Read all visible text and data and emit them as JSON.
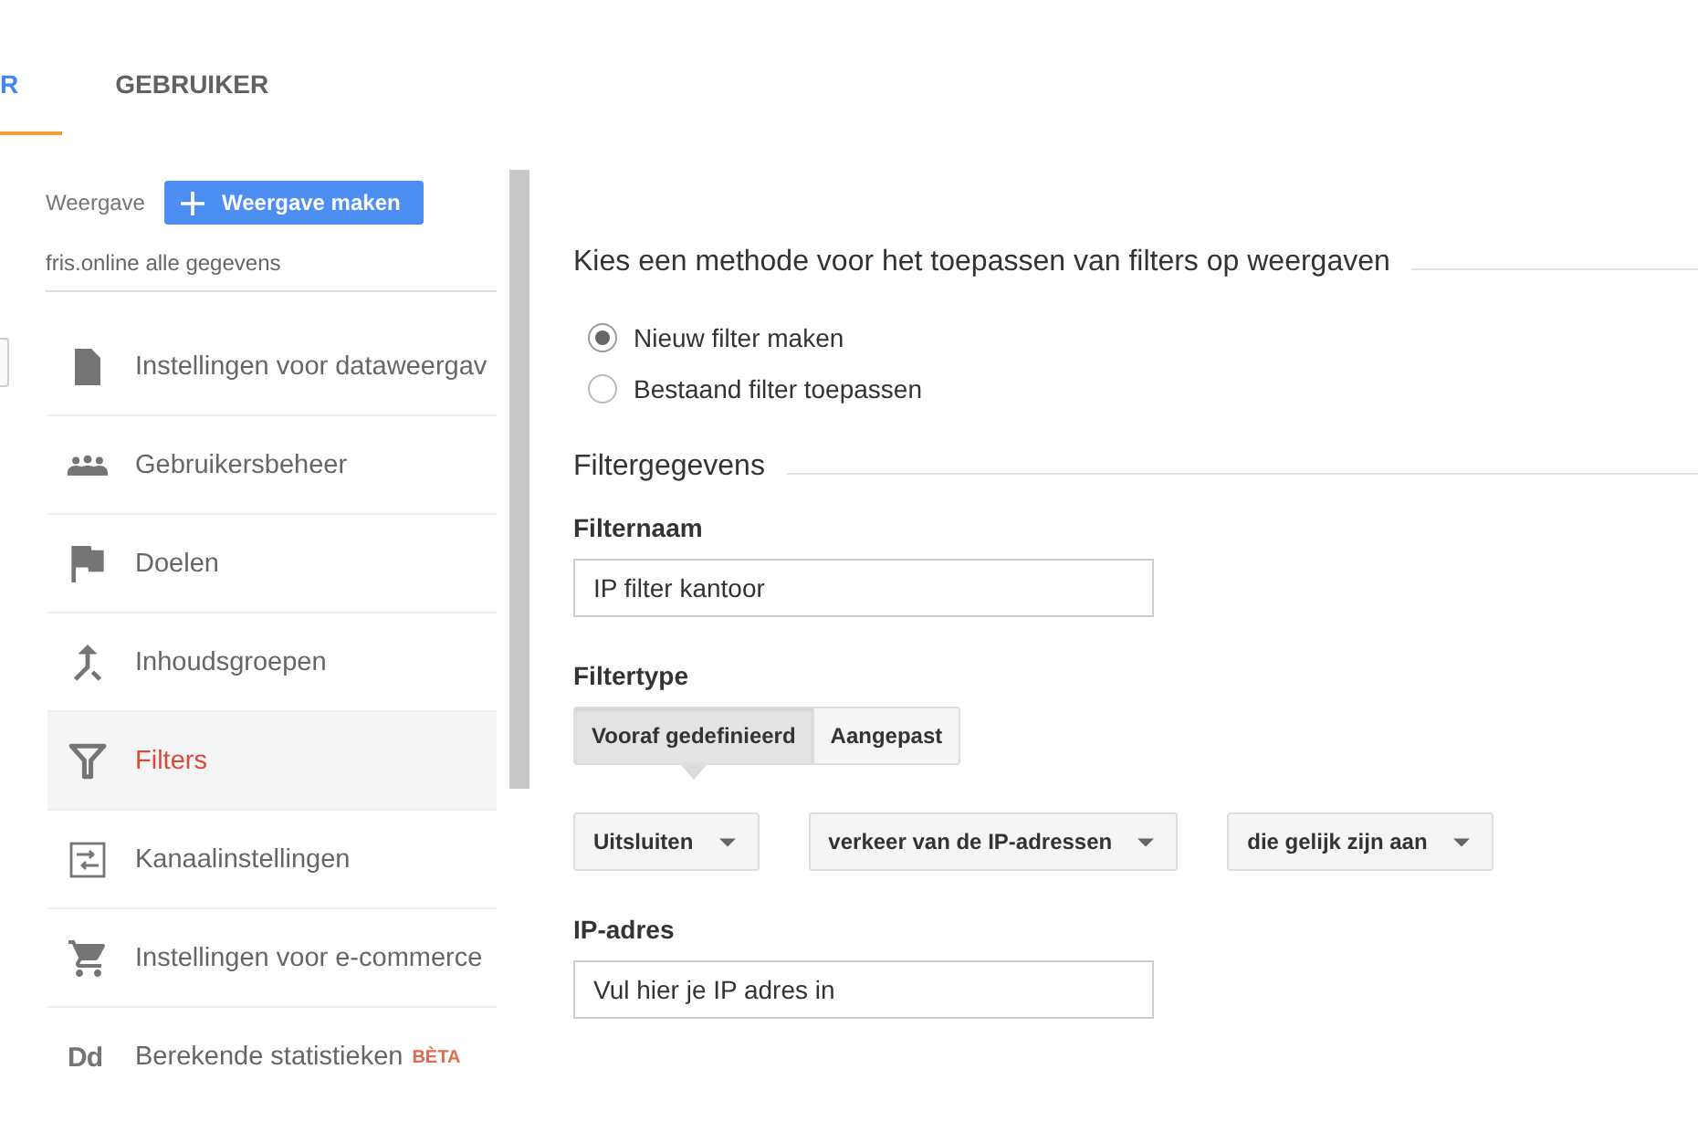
{
  "tabs": [
    {
      "label": "R",
      "selected": true
    },
    {
      "label": "GEBRUIKER",
      "selected": false
    }
  ],
  "sidebar": {
    "view_label": "Weergave",
    "create_button": "Weergave maken",
    "view_name": "fris.online alle gegevens",
    "items": [
      {
        "label": "Instellingen voor dataweergav",
        "selected": false
      },
      {
        "label": "Gebruikersbeheer",
        "selected": false
      },
      {
        "label": "Doelen",
        "selected": false
      },
      {
        "label": "Inhoudsgroepen",
        "selected": false
      },
      {
        "label": "Filters",
        "selected": true
      },
      {
        "label": "Kanaalinstellingen",
        "selected": false
      },
      {
        "label": "Instellingen voor e-commerce",
        "selected": false
      },
      {
        "label": "Berekende statistieken",
        "selected": false,
        "icon_text": "Dd",
        "badge": "BÈTA"
      }
    ]
  },
  "method": {
    "title": "Kies een methode voor het toepassen van filters op weergaven",
    "options": [
      {
        "label": "Nieuw filter maken",
        "selected": true
      },
      {
        "label": "Bestaand filter toepassen",
        "selected": false
      }
    ]
  },
  "filter_details": {
    "title": "Filtergegevens",
    "name_label": "Filternaam",
    "name_value": "IP filter kantoor",
    "type_label": "Filtertype",
    "type_options": [
      {
        "label": "Vooraf gedefinieerd",
        "selected": true
      },
      {
        "label": "Aangepast",
        "selected": false
      }
    ],
    "dropdowns": [
      "Uitsluiten",
      "verkeer van de IP-adressen",
      "die gelijk zijn aan"
    ],
    "ip_label": "IP-adres",
    "ip_value": "Vul hier je IP adres in"
  }
}
